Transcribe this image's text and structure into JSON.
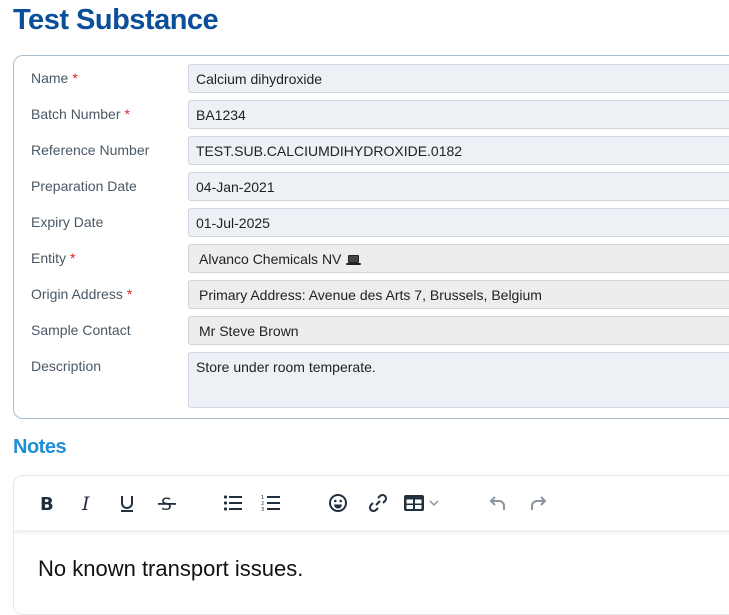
{
  "header": {
    "title": "Test Substance"
  },
  "form": {
    "fields": [
      {
        "label": "Name",
        "required": "*",
        "value": "Calcium dihydroxide"
      },
      {
        "label": "Batch Number",
        "required": "*",
        "value": "BA1234"
      },
      {
        "label": "Reference Number",
        "value": "TEST.SUB.CALCIUMDIHYDROXIDE.0182"
      },
      {
        "label": "Preparation Date",
        "value": "04-Jan-2021"
      },
      {
        "label": "Expiry Date",
        "value": "01-Jul-2025"
      },
      {
        "label": "Entity",
        "required": "*",
        "value": "Alvanco Chemicals NV",
        "icon": "laptop-icon"
      },
      {
        "label": "Origin Address",
        "required": "*",
        "value": "Primary Address: Avenue des Arts 7, Brussels, Belgium"
      },
      {
        "label": "Sample Contact",
        "value": "Mr Steve Brown"
      },
      {
        "label": "Description",
        "value": "Store under room temperate."
      }
    ]
  },
  "notes": {
    "title": "Notes",
    "toolbar": [
      "bold-icon",
      "italic-icon",
      "underline-icon",
      "strikethrough-icon",
      "bulleted-list-icon",
      "numbered-list-icon",
      "emoji-icon",
      "link-icon",
      "table-icon",
      "chevron-down-icon",
      "undo-icon",
      "redo-icon"
    ],
    "content": "No known transport issues."
  }
}
